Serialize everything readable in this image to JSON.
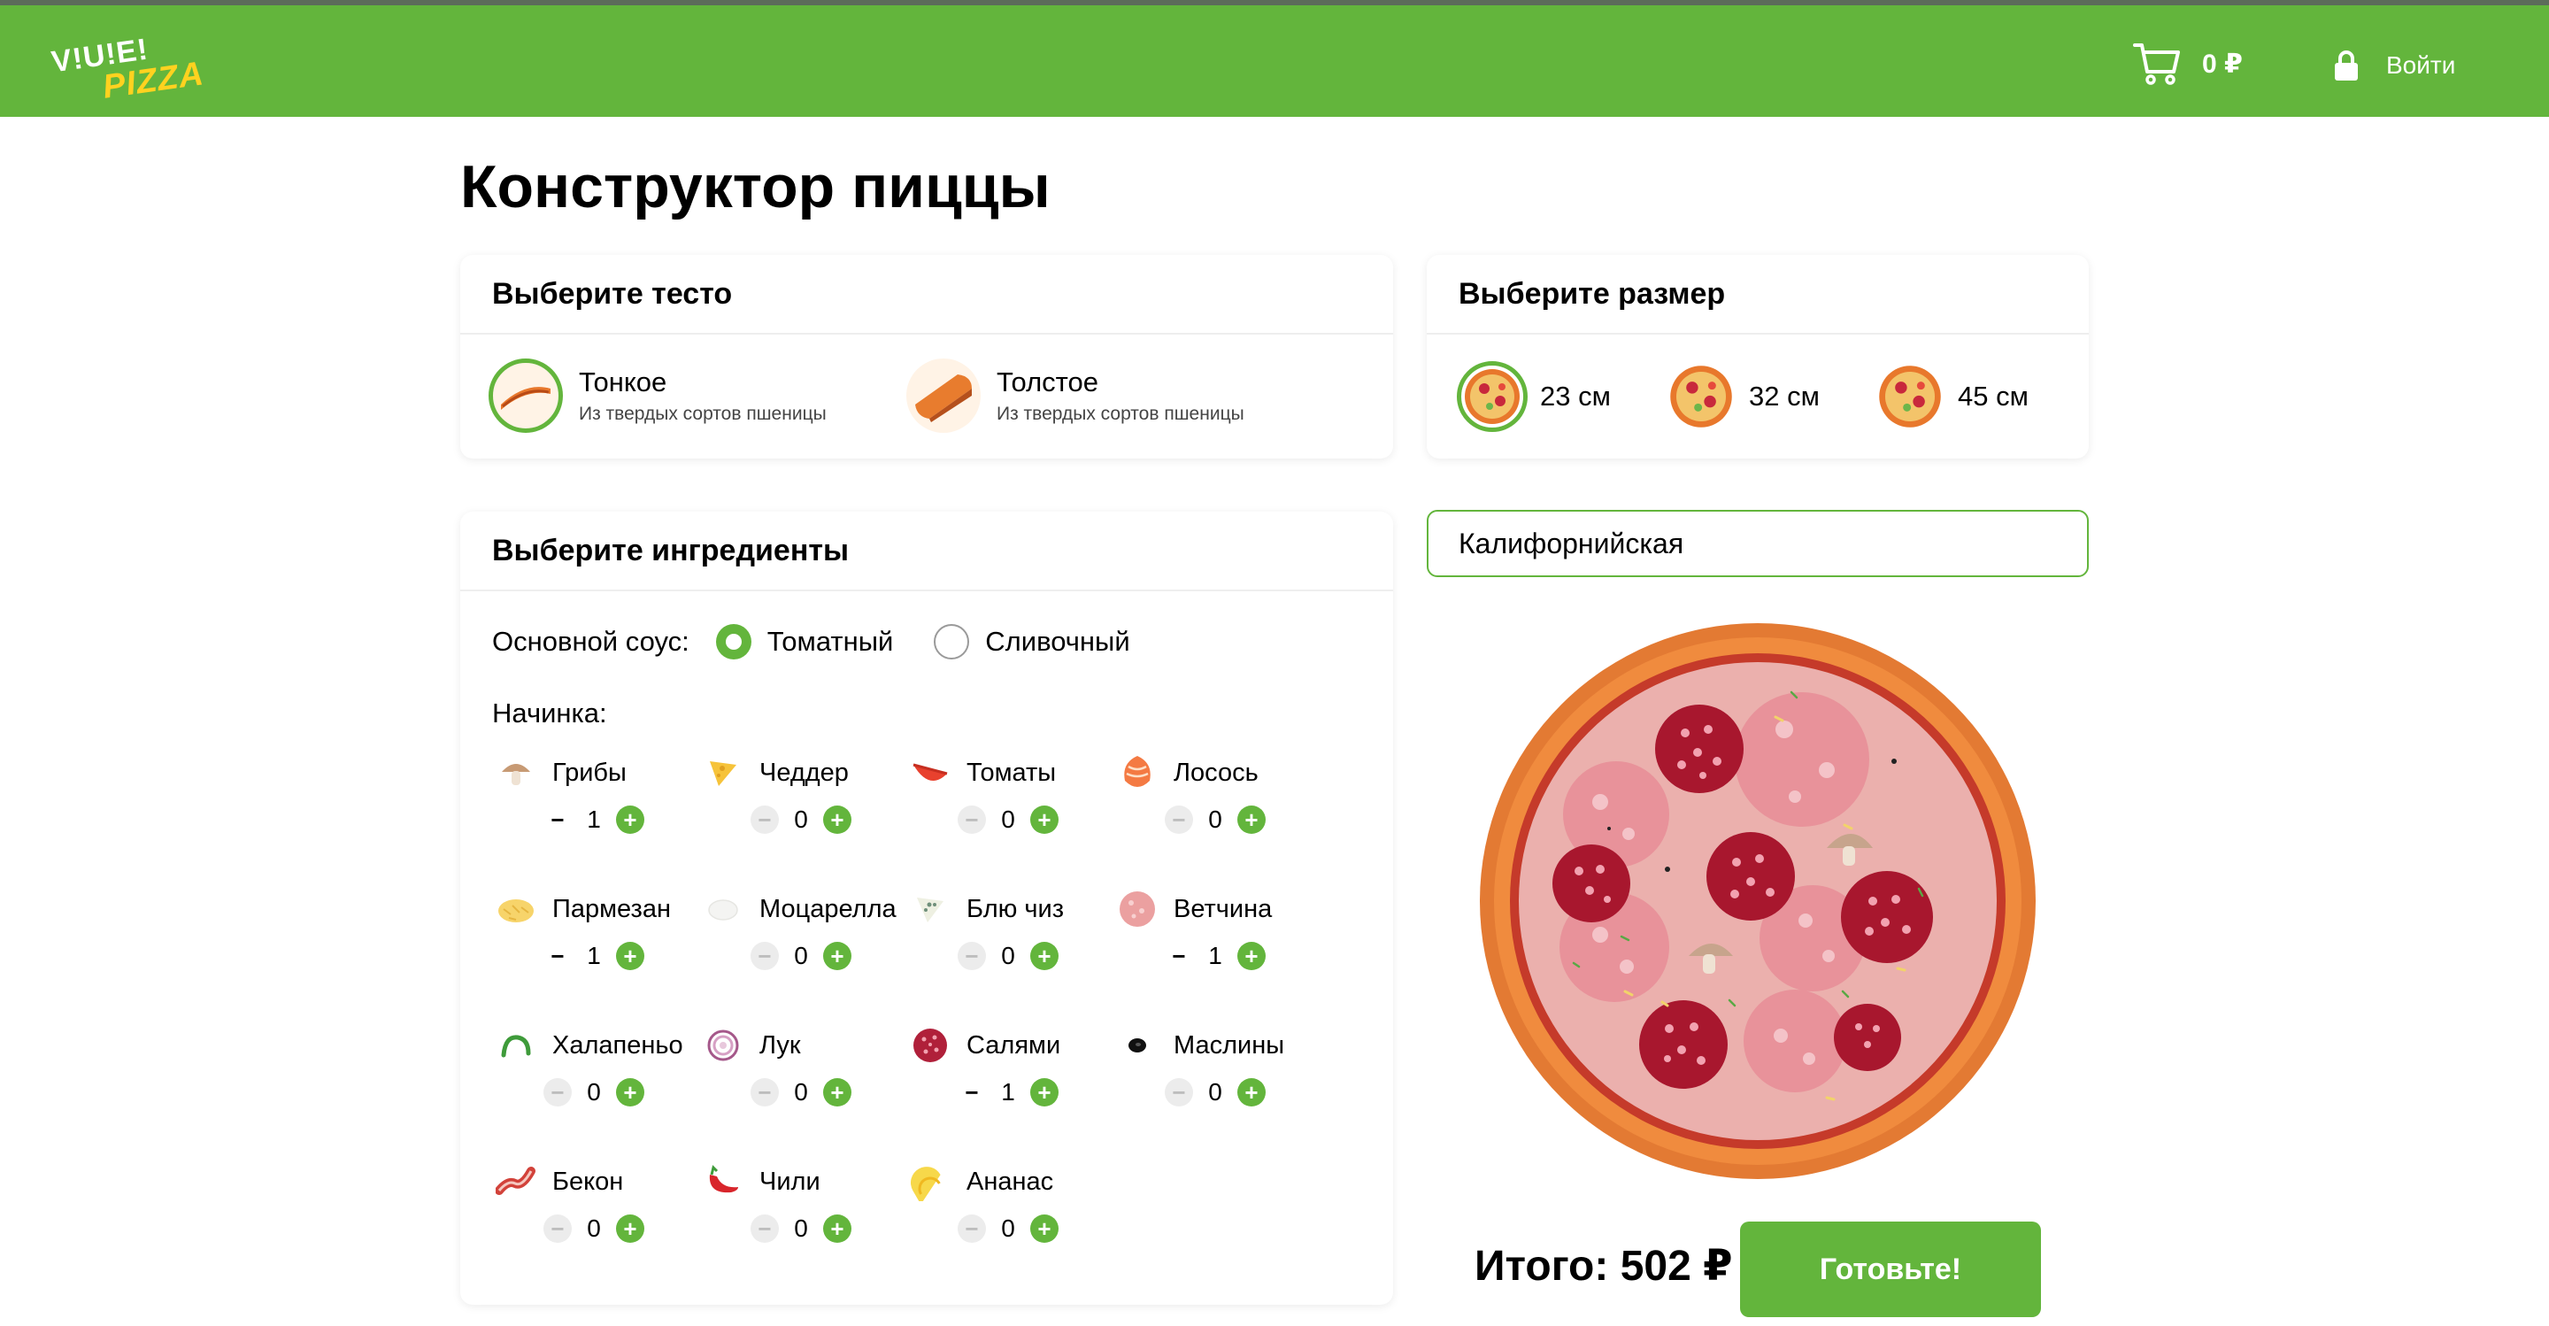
{
  "header": {
    "logo_line1": "V!U!E!",
    "logo_line2": "PIZZA",
    "cart_total": "0 ₽",
    "login_label": "Войти"
  },
  "title": "Конструктор пиццы",
  "dough": {
    "heading": "Выберите тесто",
    "options": [
      {
        "name": "Тонкое",
        "desc": "Из твердых сортов пшеницы",
        "selected": true
      },
      {
        "name": "Толстое",
        "desc": "Из твердых сортов пшеницы",
        "selected": false
      }
    ]
  },
  "size": {
    "heading": "Выберите размер",
    "options": [
      {
        "label": "23 см",
        "selected": true
      },
      {
        "label": "32 см",
        "selected": false
      },
      {
        "label": "45 см",
        "selected": false
      }
    ]
  },
  "ingredients": {
    "heading": "Выберите ингредиенты",
    "sauce_label": "Основной соус:",
    "sauces": [
      {
        "label": "Томатный",
        "selected": true
      },
      {
        "label": "Сливочный",
        "selected": false
      }
    ],
    "filling_label": "Начинка:",
    "items": [
      {
        "name": "Грибы",
        "count": "1",
        "icon": "mushroom-icon"
      },
      {
        "name": "Чеддер",
        "count": "0",
        "icon": "cheddar-icon"
      },
      {
        "name": "Томаты",
        "count": "0",
        "icon": "tomato-icon"
      },
      {
        "name": "Лосось",
        "count": "0",
        "icon": "salmon-icon"
      },
      {
        "name": "Пармезан",
        "count": "1",
        "icon": "parmesan-icon"
      },
      {
        "name": "Моцарелла",
        "count": "0",
        "icon": "mozzarella-icon"
      },
      {
        "name": "Блю чиз",
        "count": "0",
        "icon": "blue-cheese-icon"
      },
      {
        "name": "Ветчина",
        "count": "1",
        "icon": "ham-icon"
      },
      {
        "name": "Халапеньо",
        "count": "0",
        "icon": "jalapeno-icon"
      },
      {
        "name": "Лук",
        "count": "0",
        "icon": "onion-icon"
      },
      {
        "name": "Салями",
        "count": "1",
        "icon": "salami-icon"
      },
      {
        "name": "Маслины",
        "count": "0",
        "icon": "olive-icon"
      },
      {
        "name": "Бекон",
        "count": "0",
        "icon": "bacon-icon"
      },
      {
        "name": "Чили",
        "count": "0",
        "icon": "chili-icon"
      },
      {
        "name": "Ананас",
        "count": "0",
        "icon": "pineapple-icon"
      }
    ]
  },
  "pizza_name": "Калифорнийская",
  "total": "Итого: 502 ₽",
  "cook_button": "Готовьте!",
  "colors": {
    "accent": "#63b53c",
    "logo_yellow": "#ffd21f"
  }
}
